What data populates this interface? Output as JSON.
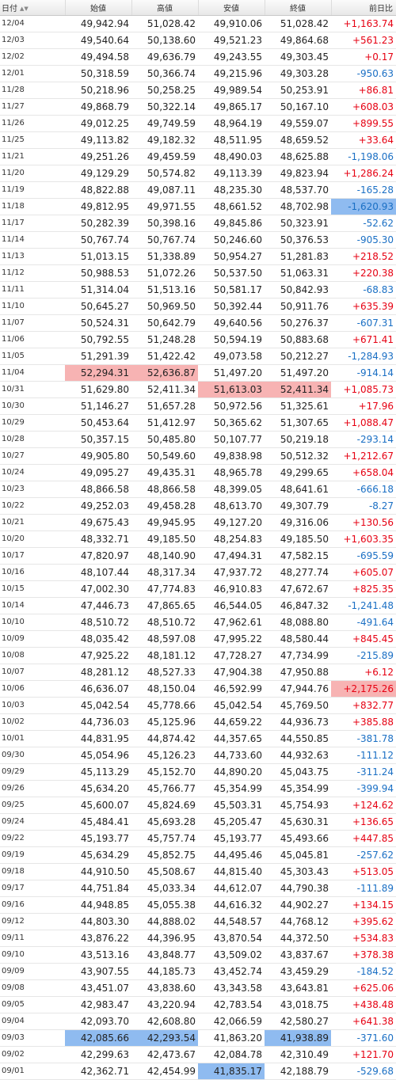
{
  "headers": {
    "date": "日付",
    "open": "始値",
    "high": "高値",
    "low": "安値",
    "close": "終値",
    "change": "前日比"
  },
  "icons": {
    "sort": "sort-arrows-icon"
  },
  "colors": {
    "positive": "#e60012",
    "negative": "#1a6fc4",
    "highlight_high": "#f7b3b3",
    "highlight_low": "#8fbbf0"
  },
  "rows": [
    {
      "date": "12/04",
      "open": "49,942.94",
      "high": "51,028.42",
      "low": "49,910.06",
      "close": "51,028.42",
      "change": "+1,163.74"
    },
    {
      "date": "12/03",
      "open": "49,540.64",
      "high": "50,138.60",
      "low": "49,521.23",
      "close": "49,864.68",
      "change": "+561.23"
    },
    {
      "date": "12/02",
      "open": "49,494.58",
      "high": "49,636.79",
      "low": "49,243.55",
      "close": "49,303.45",
      "change": "+0.17"
    },
    {
      "date": "12/01",
      "open": "50,318.59",
      "high": "50,366.74",
      "low": "49,215.96",
      "close": "49,303.28",
      "change": "-950.63"
    },
    {
      "date": "11/28",
      "open": "50,218.96",
      "high": "50,258.25",
      "low": "49,989.54",
      "close": "50,253.91",
      "change": "+86.81"
    },
    {
      "date": "11/27",
      "open": "49,868.79",
      "high": "50,322.14",
      "low": "49,865.17",
      "close": "50,167.10",
      "change": "+608.03"
    },
    {
      "date": "11/26",
      "open": "49,012.25",
      "high": "49,749.59",
      "low": "48,964.19",
      "close": "49,559.07",
      "change": "+899.55"
    },
    {
      "date": "11/25",
      "open": "49,113.82",
      "high": "49,182.32",
      "low": "48,511.95",
      "close": "48,659.52",
      "change": "+33.64"
    },
    {
      "date": "11/21",
      "open": "49,251.26",
      "high": "49,459.59",
      "low": "48,490.03",
      "close": "48,625.88",
      "change": "-1,198.06"
    },
    {
      "date": "11/20",
      "open": "49,129.29",
      "high": "50,574.82",
      "low": "49,113.39",
      "close": "49,823.94",
      "change": "+1,286.24"
    },
    {
      "date": "11/19",
      "open": "48,822.88",
      "high": "49,087.11",
      "low": "48,235.30",
      "close": "48,537.70",
      "change": "-165.28"
    },
    {
      "date": "11/18",
      "open": "49,812.95",
      "high": "49,971.55",
      "low": "48,661.52",
      "close": "48,702.98",
      "change": "-1,620.93",
      "hl": {
        "change": "low"
      }
    },
    {
      "date": "11/17",
      "open": "50,282.39",
      "high": "50,398.16",
      "low": "49,845.86",
      "close": "50,323.91",
      "change": "-52.62"
    },
    {
      "date": "11/14",
      "open": "50,767.74",
      "high": "50,767.74",
      "low": "50,246.60",
      "close": "50,376.53",
      "change": "-905.30"
    },
    {
      "date": "11/13",
      "open": "51,013.15",
      "high": "51,338.89",
      "low": "50,954.27",
      "close": "51,281.83",
      "change": "+218.52"
    },
    {
      "date": "11/12",
      "open": "50,988.53",
      "high": "51,072.26",
      "low": "50,537.50",
      "close": "51,063.31",
      "change": "+220.38"
    },
    {
      "date": "11/11",
      "open": "51,314.04",
      "high": "51,513.16",
      "low": "50,581.17",
      "close": "50,842.93",
      "change": "-68.83"
    },
    {
      "date": "11/10",
      "open": "50,645.27",
      "high": "50,969.50",
      "low": "50,392.44",
      "close": "50,911.76",
      "change": "+635.39"
    },
    {
      "date": "11/07",
      "open": "50,524.31",
      "high": "50,642.79",
      "low": "49,640.56",
      "close": "50,276.37",
      "change": "-607.31"
    },
    {
      "date": "11/06",
      "open": "50,792.55",
      "high": "51,248.28",
      "low": "50,594.19",
      "close": "50,883.68",
      "change": "+671.41"
    },
    {
      "date": "11/05",
      "open": "51,291.39",
      "high": "51,422.42",
      "low": "49,073.58",
      "close": "50,212.27",
      "change": "-1,284.93"
    },
    {
      "date": "11/04",
      "open": "52,294.31",
      "high": "52,636.87",
      "low": "51,497.20",
      "close": "51,497.20",
      "change": "-914.14",
      "hl": {
        "open": "high",
        "high": "high"
      }
    },
    {
      "date": "10/31",
      "open": "51,629.80",
      "high": "52,411.34",
      "low": "51,613.03",
      "close": "52,411.34",
      "change": "+1,085.73",
      "hl": {
        "low": "high",
        "close": "high"
      }
    },
    {
      "date": "10/30",
      "open": "51,146.27",
      "high": "51,657.28",
      "low": "50,972.56",
      "close": "51,325.61",
      "change": "+17.96"
    },
    {
      "date": "10/29",
      "open": "50,453.64",
      "high": "51,412.97",
      "low": "50,365.62",
      "close": "51,307.65",
      "change": "+1,088.47"
    },
    {
      "date": "10/28",
      "open": "50,357.15",
      "high": "50,485.80",
      "low": "50,107.77",
      "close": "50,219.18",
      "change": "-293.14"
    },
    {
      "date": "10/27",
      "open": "49,905.80",
      "high": "50,549.60",
      "low": "49,838.98",
      "close": "50,512.32",
      "change": "+1,212.67"
    },
    {
      "date": "10/24",
      "open": "49,095.27",
      "high": "49,435.31",
      "low": "48,965.78",
      "close": "49,299.65",
      "change": "+658.04"
    },
    {
      "date": "10/23",
      "open": "48,866.58",
      "high": "48,866.58",
      "low": "48,399.05",
      "close": "48,641.61",
      "change": "-666.18"
    },
    {
      "date": "10/22",
      "open": "49,252.03",
      "high": "49,458.28",
      "low": "48,613.70",
      "close": "49,307.79",
      "change": "-8.27"
    },
    {
      "date": "10/21",
      "open": "49,675.43",
      "high": "49,945.95",
      "low": "49,127.20",
      "close": "49,316.06",
      "change": "+130.56"
    },
    {
      "date": "10/20",
      "open": "48,332.71",
      "high": "49,185.50",
      "low": "48,254.83",
      "close": "49,185.50",
      "change": "+1,603.35"
    },
    {
      "date": "10/17",
      "open": "47,820.97",
      "high": "48,140.90",
      "low": "47,494.31",
      "close": "47,582.15",
      "change": "-695.59"
    },
    {
      "date": "10/16",
      "open": "48,107.44",
      "high": "48,317.34",
      "low": "47,937.72",
      "close": "48,277.74",
      "change": "+605.07"
    },
    {
      "date": "10/15",
      "open": "47,002.30",
      "high": "47,774.83",
      "low": "46,910.83",
      "close": "47,672.67",
      "change": "+825.35"
    },
    {
      "date": "10/14",
      "open": "47,446.73",
      "high": "47,865.65",
      "low": "46,544.05",
      "close": "46,847.32",
      "change": "-1,241.48"
    },
    {
      "date": "10/10",
      "open": "48,510.72",
      "high": "48,510.72",
      "low": "47,962.61",
      "close": "48,088.80",
      "change": "-491.64"
    },
    {
      "date": "10/09",
      "open": "48,035.42",
      "high": "48,597.08",
      "low": "47,995.22",
      "close": "48,580.44",
      "change": "+845.45"
    },
    {
      "date": "10/08",
      "open": "47,925.22",
      "high": "48,181.12",
      "low": "47,728.27",
      "close": "47,734.99",
      "change": "-215.89"
    },
    {
      "date": "10/07",
      "open": "48,281.12",
      "high": "48,527.33",
      "low": "47,904.38",
      "close": "47,950.88",
      "change": "+6.12"
    },
    {
      "date": "10/06",
      "open": "46,636.07",
      "high": "48,150.04",
      "low": "46,592.99",
      "close": "47,944.76",
      "change": "+2,175.26",
      "hl": {
        "change": "high"
      }
    },
    {
      "date": "10/03",
      "open": "45,042.54",
      "high": "45,778.66",
      "low": "45,042.54",
      "close": "45,769.50",
      "change": "+832.77"
    },
    {
      "date": "10/02",
      "open": "44,736.03",
      "high": "45,125.96",
      "low": "44,659.22",
      "close": "44,936.73",
      "change": "+385.88"
    },
    {
      "date": "10/01",
      "open": "44,831.95",
      "high": "44,874.42",
      "low": "44,357.65",
      "close": "44,550.85",
      "change": "-381.78"
    },
    {
      "date": "09/30",
      "open": "45,054.96",
      "high": "45,126.23",
      "low": "44,733.60",
      "close": "44,932.63",
      "change": "-111.12"
    },
    {
      "date": "09/29",
      "open": "45,113.29",
      "high": "45,152.70",
      "low": "44,890.20",
      "close": "45,043.75",
      "change": "-311.24"
    },
    {
      "date": "09/26",
      "open": "45,634.20",
      "high": "45,766.77",
      "low": "45,354.99",
      "close": "45,354.99",
      "change": "-399.94"
    },
    {
      "date": "09/25",
      "open": "45,600.07",
      "high": "45,824.69",
      "low": "45,503.31",
      "close": "45,754.93",
      "change": "+124.62"
    },
    {
      "date": "09/24",
      "open": "45,484.41",
      "high": "45,693.28",
      "low": "45,205.47",
      "close": "45,630.31",
      "change": "+136.65"
    },
    {
      "date": "09/22",
      "open": "45,193.77",
      "high": "45,757.74",
      "low": "45,193.77",
      "close": "45,493.66",
      "change": "+447.85"
    },
    {
      "date": "09/19",
      "open": "45,634.29",
      "high": "45,852.75",
      "low": "44,495.46",
      "close": "45,045.81",
      "change": "-257.62"
    },
    {
      "date": "09/18",
      "open": "44,910.50",
      "high": "45,508.67",
      "low": "44,815.40",
      "close": "45,303.43",
      "change": "+513.05"
    },
    {
      "date": "09/17",
      "open": "44,751.84",
      "high": "45,033.34",
      "low": "44,612.07",
      "close": "44,790.38",
      "change": "-111.89"
    },
    {
      "date": "09/16",
      "open": "44,948.85",
      "high": "45,055.38",
      "low": "44,616.32",
      "close": "44,902.27",
      "change": "+134.15"
    },
    {
      "date": "09/12",
      "open": "44,803.30",
      "high": "44,888.02",
      "low": "44,548.57",
      "close": "44,768.12",
      "change": "+395.62"
    },
    {
      "date": "09/11",
      "open": "43,876.22",
      "high": "44,396.95",
      "low": "43,870.54",
      "close": "44,372.50",
      "change": "+534.83"
    },
    {
      "date": "09/10",
      "open": "43,513.16",
      "high": "43,848.77",
      "low": "43,509.02",
      "close": "43,837.67",
      "change": "+378.38"
    },
    {
      "date": "09/09",
      "open": "43,907.55",
      "high": "44,185.73",
      "low": "43,452.74",
      "close": "43,459.29",
      "change": "-184.52"
    },
    {
      "date": "09/08",
      "open": "43,451.07",
      "high": "43,838.60",
      "low": "43,343.58",
      "close": "43,643.81",
      "change": "+625.06"
    },
    {
      "date": "09/05",
      "open": "42,983.47",
      "high": "43,220.94",
      "low": "42,783.54",
      "close": "43,018.75",
      "change": "+438.48"
    },
    {
      "date": "09/04",
      "open": "42,093.70",
      "high": "42,608.80",
      "low": "42,066.59",
      "close": "42,580.27",
      "change": "+641.38"
    },
    {
      "date": "09/03",
      "open": "42,085.66",
      "high": "42,293.54",
      "low": "41,863.20",
      "close": "41,938.89",
      "change": "-371.60",
      "hl": {
        "open": "low",
        "high": "low",
        "close": "low"
      }
    },
    {
      "date": "09/02",
      "open": "42,299.63",
      "high": "42,473.67",
      "low": "42,084.78",
      "close": "42,310.49",
      "change": "+121.70"
    },
    {
      "date": "09/01",
      "open": "42,362.71",
      "high": "42,454.99",
      "low": "41,835.17",
      "close": "42,188.79",
      "change": "-529.68",
      "hl": {
        "low": "low"
      }
    }
  ]
}
